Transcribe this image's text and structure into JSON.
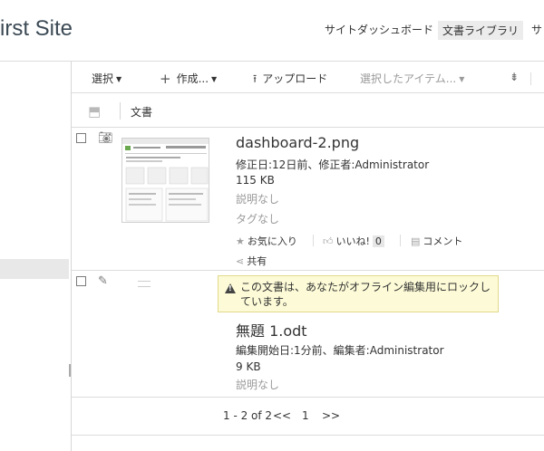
{
  "header": {
    "site_title": "irst Site",
    "nav": [
      "サイトダッシュボード",
      "文書ライブラリ",
      "サ"
    ]
  },
  "toolbar": {
    "select_label": "選択",
    "create_label": "作成...",
    "upload_label": "アップロード",
    "selected_items_label": "選択したアイテム..."
  },
  "list": {
    "column_header": "文書"
  },
  "items": [
    {
      "name": "dashboard-2.png",
      "modified": "修正日:12日前、修正者:Administrator",
      "size": "115 KB",
      "description": "説明なし",
      "tags": "タグなし",
      "favorite_label": "お気に入り",
      "like_label": "いいね!",
      "like_count": "0",
      "comment_label": "コメント",
      "share_label": "共有"
    },
    {
      "lock_notice": "この文書は、あなたがオフライン編集用にロックしています。",
      "name": "無題 1.odt",
      "editing": "編集開始日:1分前、編集者:Administrator",
      "size": "9 KB",
      "description": "説明なし"
    }
  ],
  "pagination": {
    "range": "1 - 2 of 2",
    "prev": "<<",
    "page": "1",
    "next": ">>"
  }
}
